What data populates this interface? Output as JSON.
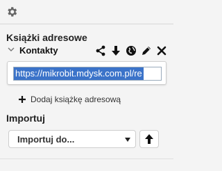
{
  "header": {
    "settings_icon": "gear-icon"
  },
  "address_books": {
    "title": "Książki adresowe",
    "items": [
      {
        "name": "Kontakty",
        "url": "https://mikrobit.mdysk.com.pl/re",
        "actions": [
          "share-icon",
          "download-icon",
          "globe-icon",
          "pencil-icon",
          "close-icon"
        ]
      }
    ],
    "add_label": "Dodaj książkę adresową"
  },
  "import": {
    "title": "Importuj",
    "select_value": "Importuj do...",
    "upload_icon": "upload-arrow-icon"
  },
  "colors": {
    "selection": "#3b73c9",
    "background": "#f4f4f4"
  }
}
